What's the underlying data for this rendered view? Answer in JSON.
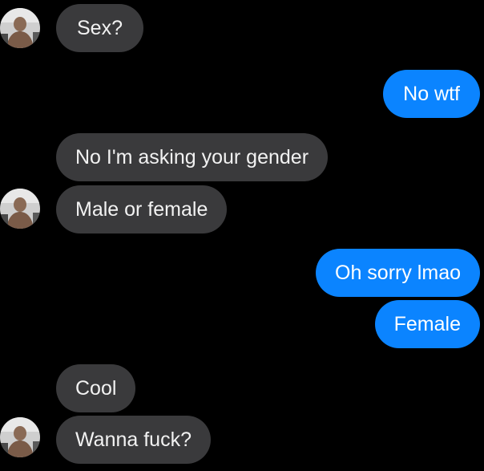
{
  "conversation": {
    "messages": [
      {
        "sender": "them",
        "text": "Sex?"
      },
      {
        "sender": "me",
        "text": "No wtf"
      },
      {
        "sender": "them",
        "text": "No I'm asking your gender"
      },
      {
        "sender": "them",
        "text": "Male or female"
      },
      {
        "sender": "me",
        "text": "Oh sorry lmao"
      },
      {
        "sender": "me",
        "text": "Female"
      },
      {
        "sender": "them",
        "text": "Cool"
      },
      {
        "sender": "them",
        "text": "Wanna fuck?"
      }
    ]
  },
  "colors": {
    "background": "#000000",
    "incoming_bubble": "#3a3a3c",
    "outgoing_bubble": "#0b84ff"
  },
  "icons": {
    "avatar": "profile-photo-avatar-icon"
  }
}
